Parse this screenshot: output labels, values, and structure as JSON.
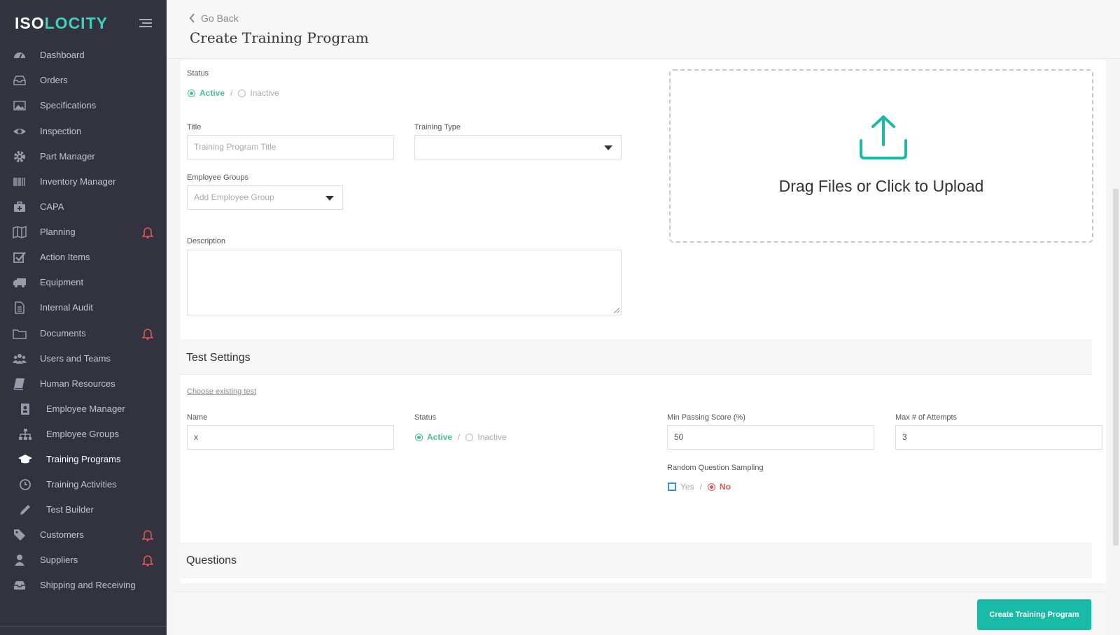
{
  "app": {
    "logo_part1": "ISO",
    "logo_part2": "LOCITY"
  },
  "sidebar": {
    "items": [
      {
        "label": "Dashboard",
        "icon": "dashboard-icon"
      },
      {
        "label": "Orders",
        "icon": "inbox-icon"
      },
      {
        "label": "Specifications",
        "icon": "image-icon"
      },
      {
        "label": "Inspection",
        "icon": "eye-icon"
      },
      {
        "label": "Part Manager",
        "icon": "gear-icon"
      },
      {
        "label": "Inventory Manager",
        "icon": "barcode-icon"
      },
      {
        "label": "CAPA",
        "icon": "medkit-icon"
      },
      {
        "label": "Planning",
        "icon": "map-icon",
        "alert": true
      },
      {
        "label": "Action Items",
        "icon": "checkbox-icon"
      },
      {
        "label": "Equipment",
        "icon": "truck-icon"
      },
      {
        "label": "Internal Audit",
        "icon": "file-icon"
      },
      {
        "label": "Documents",
        "icon": "folder-icon",
        "alert": true
      },
      {
        "label": "Users and Teams",
        "icon": "users-icon"
      },
      {
        "label": "Human Resources",
        "icon": "book-icon"
      },
      {
        "label": "Employee Manager",
        "icon": "id-badge-icon",
        "sub": true
      },
      {
        "label": "Employee Groups",
        "icon": "sitemap-icon",
        "sub": true
      },
      {
        "label": "Training Programs",
        "icon": "graduation-cap-icon",
        "sub": true,
        "active": true
      },
      {
        "label": "Training Activities",
        "icon": "clock-icon",
        "sub": true
      },
      {
        "label": "Test Builder",
        "icon": "pencil-icon",
        "sub": true
      },
      {
        "label": "Customers",
        "icon": "tag-icon",
        "alert": true
      },
      {
        "label": "Suppliers",
        "icon": "supplier-icon",
        "alert": true
      },
      {
        "label": "Shipping and Receiving",
        "icon": "inbox-tray-icon"
      }
    ]
  },
  "header": {
    "go_back": "Go Back",
    "title": "Create Training Program"
  },
  "form": {
    "status_label": "Status",
    "status_active": "Active",
    "status_sep": "/",
    "status_inactive": "Inactive",
    "title_label": "Title",
    "title_placeholder": "Training Program Title",
    "training_type_label": "Training Type",
    "training_type_value": "",
    "employee_groups_label": "Employee Groups",
    "employee_groups_placeholder": "Add Employee Group",
    "description_label": "Description",
    "upload_text": "Drag Files or Click to Upload"
  },
  "test_settings": {
    "heading": "Test Settings",
    "choose_existing": "Choose existing test",
    "name_label": "Name",
    "name_value": "x",
    "status_label": "Status",
    "status_active": "Active",
    "status_sep": "/",
    "status_inactive": "Inactive",
    "min_score_label": "Min Passing Score (%)",
    "min_score_value": "50",
    "max_attempts_label": "Max # of Attempts",
    "max_attempts_value": "3",
    "sampling_label": "Random Question Sampling",
    "sampling_yes": "Yes",
    "sampling_sep": "/",
    "sampling_no": "No"
  },
  "questions": {
    "heading": "Questions"
  },
  "footer": {
    "create_button": "Create Training Program"
  },
  "colors": {
    "sidebar_bg": "#333340",
    "accent": "#1abba6",
    "active_green": "#4bc08c",
    "alert_red": "#e05555"
  }
}
